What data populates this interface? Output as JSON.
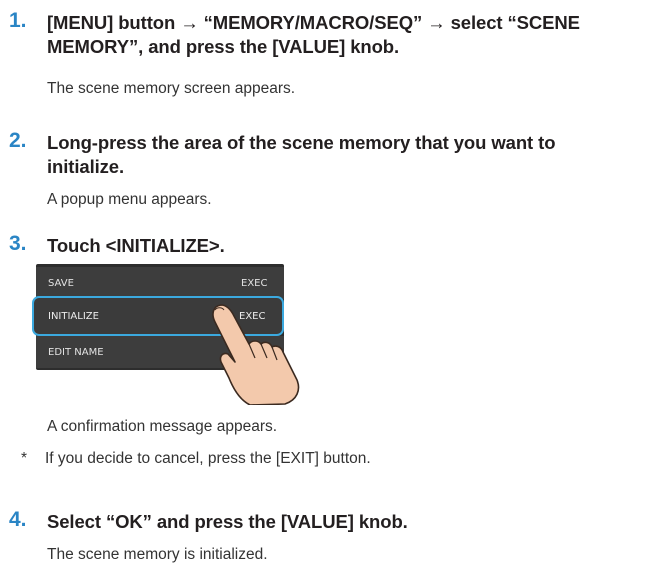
{
  "steps": [
    {
      "number": "1.",
      "title_lines": [
        "[MENU] button → “MEMORY/MACRO/SEQ” → select “SCENE",
        "MEMORY”, and press the [VALUE] knob."
      ],
      "result": "The scene memory screen appears."
    },
    {
      "number": "2.",
      "title_lines": [
        "Long-press the area of the scene memory that you want to",
        "initialize."
      ],
      "result": "A popup menu appears."
    },
    {
      "number": "3.",
      "title_lines": [
        "Touch <INITIALIZE>."
      ],
      "result": "A confirmation message appears.",
      "note_star": "*",
      "note": "If you decide to cancel, press the [EXIT] button."
    },
    {
      "number": "4.",
      "title_lines": [
        "Select “OK” and press the [VALUE] knob."
      ],
      "result": "The scene memory is initialized."
    }
  ],
  "screen_menu": {
    "items": [
      {
        "label": "SAVE",
        "action": "EXEC"
      },
      {
        "label": "INITIALIZE",
        "action": "EXEC"
      },
      {
        "label": "EDIT NAME",
        "action": ""
      }
    ],
    "highlight_color": "#3ba9df",
    "selected_index": 1
  },
  "colors": {
    "step_number": "#2a85c5",
    "text": "#231f20"
  },
  "icons": {
    "pointer": "pointing-hand-icon"
  }
}
